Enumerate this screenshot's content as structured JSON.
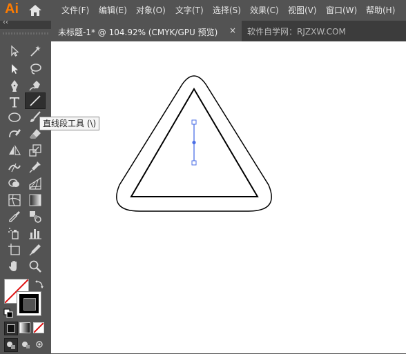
{
  "app": {
    "logo": "Ai"
  },
  "menu": [
    "文件(F)",
    "编辑(E)",
    "对象(O)",
    "文字(T)",
    "选择(S)",
    "效果(C)",
    "视图(V)",
    "窗口(W)",
    "帮助(H)"
  ],
  "tabs": {
    "active": "未标题-1* @ 104.92% (CMYK/GPU 预览)",
    "close": "×",
    "other": "软件自学网：RJZXW.COM"
  },
  "toolbar": {
    "collapse": "‹‹"
  },
  "tooltip": "直线段工具 (\\)",
  "colors": {
    "chrome": "#535353",
    "dark": "#3c3c3c",
    "canvas": "#ffffff",
    "selection": "#4a6ee6",
    "stroke": "#000000",
    "logo": "#ff7c00"
  },
  "canvas": {
    "shapes": [
      "outer-rounded-triangle",
      "inner-triangle",
      "selected-line-segment"
    ]
  }
}
